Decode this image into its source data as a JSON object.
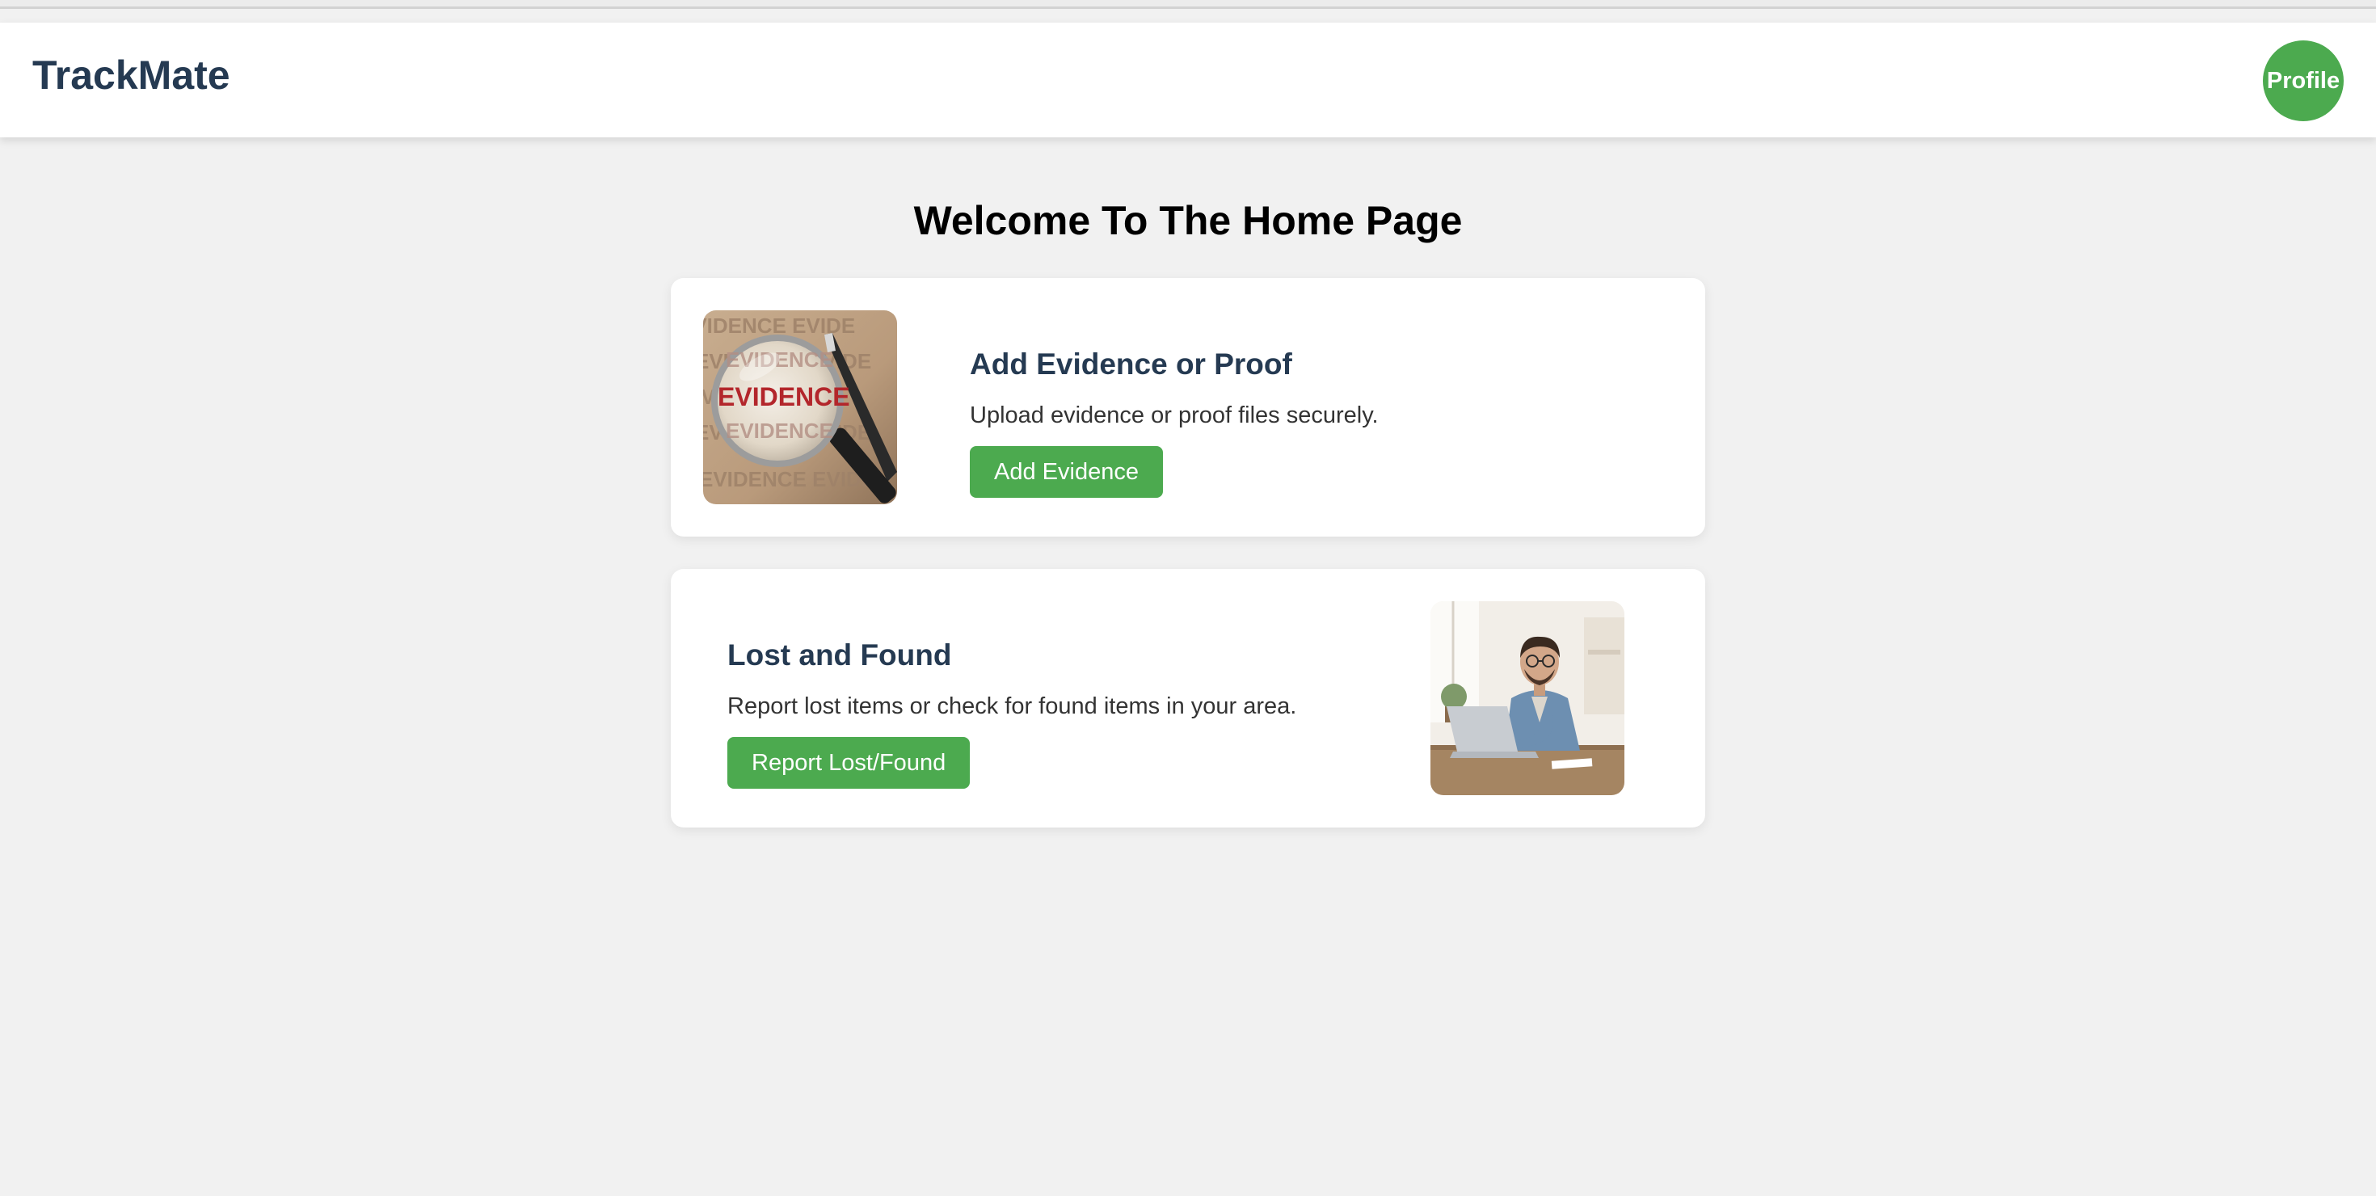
{
  "app": {
    "brand": "TrackMate",
    "profile_label": "Profile"
  },
  "main": {
    "title": "Welcome To The Home Page",
    "cards": [
      {
        "title": "Add Evidence or Proof",
        "description": "Upload evidence or proof files securely.",
        "button_label": "Add Evidence",
        "image_text": "EVIDENCE",
        "image": "evidence-magnifier-photo"
      },
      {
        "title": "Lost and Found",
        "description": "Report lost items or check for found items in your area.",
        "button_label": "Report Lost/Found",
        "image": "man-with-laptop-photo"
      }
    ]
  },
  "colors": {
    "accent_green": "#4caa4f",
    "heading_navy": "#253a52",
    "page_background": "#f1f1f1"
  }
}
